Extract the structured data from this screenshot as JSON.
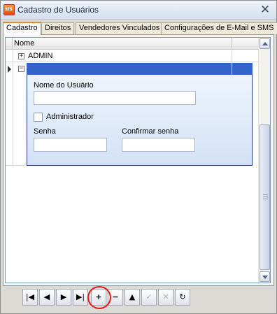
{
  "window": {
    "title": "Cadastro de Usuários",
    "app_icon": "app-logo-icon",
    "close_glyph": "✕"
  },
  "tabs": [
    {
      "label": "Cadastro",
      "active": true
    },
    {
      "label": "Direitos",
      "active": false
    },
    {
      "label": "Vendedores Vinculados",
      "active": false
    },
    {
      "label": "Configurações de E-Mail e SMS",
      "active": false
    }
  ],
  "grid": {
    "column_header": "Nome",
    "rows": [
      {
        "name": "ADMIN",
        "expander": "+"
      },
      {
        "name": "",
        "expander": "−",
        "selected": true
      }
    ]
  },
  "form": {
    "username_label": "Nome do Usuário",
    "username_value": "",
    "admin_label": "Administrador",
    "admin_checked": false,
    "password_label": "Senha",
    "password_value": "",
    "confirm_label": "Confirmar senha",
    "confirm_value": ""
  },
  "navigator": {
    "first": "|◀",
    "prior": "◀",
    "next": "▶",
    "last": "▶|",
    "insert": "+",
    "delete": "−",
    "edit": "▲",
    "post": "✓",
    "cancel": "✕",
    "refresh": "↻"
  },
  "colors": {
    "selection": "#3165c8",
    "annotation_ring": "#e01c1c"
  }
}
